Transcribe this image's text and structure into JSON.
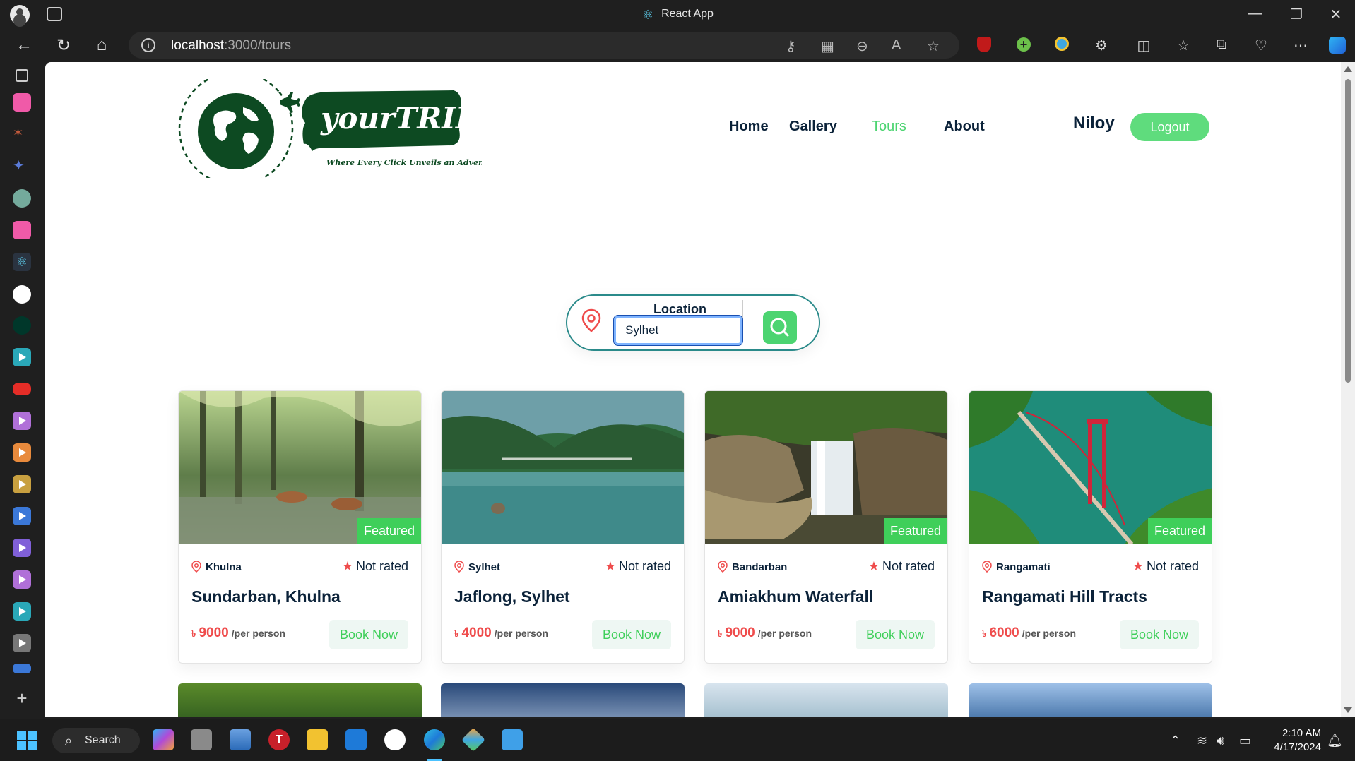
{
  "browser": {
    "tab_title": "React App",
    "url_host": "localhost",
    "url_path": ":3000/tours"
  },
  "site": {
    "brand": "yourTRIP",
    "tagline": "Where Every Click Unveils an Adventure",
    "nav": [
      {
        "label": "Home",
        "active": false
      },
      {
        "label": "Gallery",
        "active": false
      },
      {
        "label": "Tours",
        "active": true
      },
      {
        "label": "About",
        "active": false
      }
    ],
    "user_name": "Niloy",
    "logout_label": "Logout"
  },
  "search": {
    "label": "Location",
    "value": "Sylhet"
  },
  "tours": [
    {
      "city": "Khulna",
      "rating": "Not rated",
      "title": "Sundarban, Khulna",
      "currency": "৳",
      "price": "9000",
      "per": "/per person",
      "book": "Book Now",
      "featured": "Featured"
    },
    {
      "city": "Sylhet",
      "rating": "Not rated",
      "title": "Jaflong, Sylhet",
      "currency": "৳",
      "price": "4000",
      "per": "/per person",
      "book": "Book Now",
      "featured": ""
    },
    {
      "city": "Bandarban",
      "rating": "Not rated",
      "title": "Amiakhum Waterfall",
      "currency": "৳",
      "price": "9000",
      "per": "/per person",
      "book": "Book Now",
      "featured": "Featured"
    },
    {
      "city": "Rangamati",
      "rating": "Not rated",
      "title": "Rangamati Hill Tracts",
      "currency": "৳",
      "price": "6000",
      "per": "/per person",
      "book": "Book Now",
      "featured": "Featured"
    }
  ],
  "taskbar": {
    "search_label": "Search",
    "time": "2:10 AM",
    "date": "4/17/2024"
  },
  "colors": {
    "accent_green": "#4cd471",
    "price_red": "#ef4c4c",
    "brand_dark_green": "#0d4a22",
    "text_navy": "#0b2239"
  }
}
